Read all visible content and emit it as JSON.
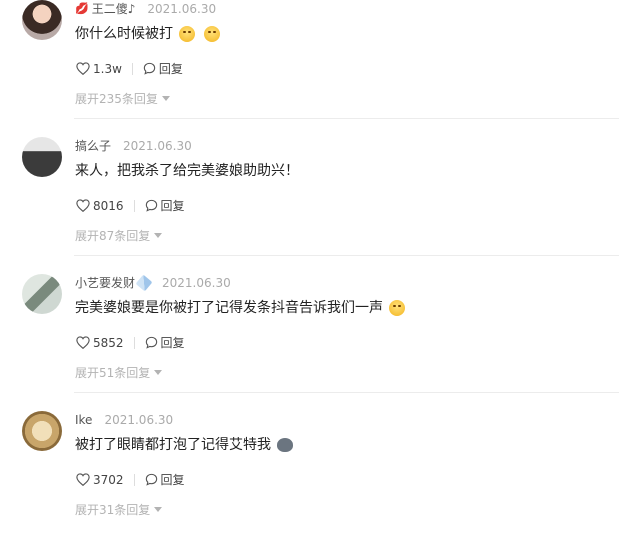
{
  "comments": [
    {
      "username": "王二傻♪",
      "username_prefix_icon": "kiss-lips-icon",
      "date": "2021.06.30",
      "text": "你什么时候被打",
      "emojis": [
        "blush-emoji",
        "blush-emoji"
      ],
      "likes": "1.3w",
      "reply_label": "回复",
      "expand_label": "展开235条回复"
    },
    {
      "username": "搞么子",
      "date": "2021.06.30",
      "text": "来人，把我杀了给完美婆娘助助兴！",
      "emojis": [],
      "likes": "8016",
      "reply_label": "回复",
      "expand_label": "展开87条回复"
    },
    {
      "username": "小艺要发财",
      "username_suffix_icon": "baby-bottle-icon",
      "date": "2021.06.30",
      "text": "完美婆娘要是你被打了记得发条抖音告诉我们一声",
      "emojis": [
        "blush-emoji"
      ],
      "likes": "5852",
      "reply_label": "回复",
      "expand_label": "展开51条回复"
    },
    {
      "username": "Ike",
      "date": "2021.06.30",
      "text": "被打了眼睛都打泡了记得艾特我",
      "emojis": [
        "cat-face-emoji"
      ],
      "likes": "3702",
      "reply_label": "回复",
      "expand_label": "展开31条回复"
    }
  ]
}
